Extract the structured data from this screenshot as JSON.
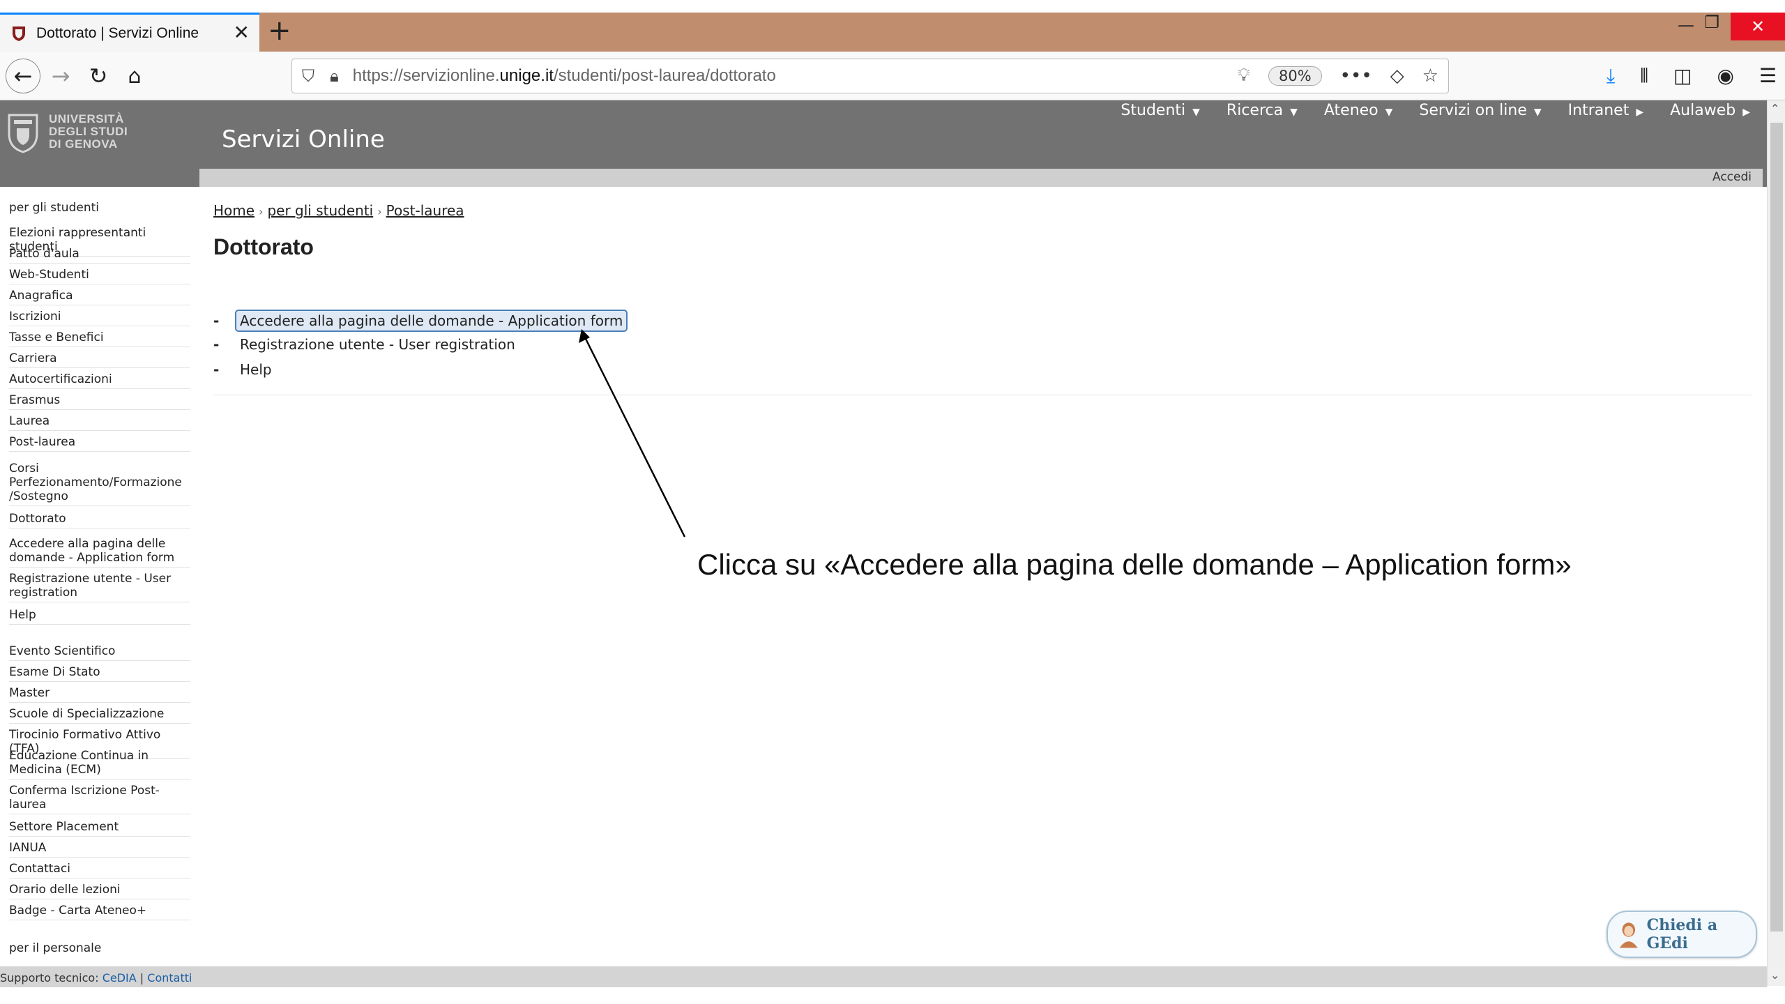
{
  "browser": {
    "tab_title": "Dottorato | Servizi Online",
    "url_prefix": "https://servizionline.",
    "url_domain": "unige.it",
    "url_path": "/studenti/post-laurea/dottorato",
    "zoom": "80%"
  },
  "site": {
    "logo_line1": "UNIVERSITÀ",
    "logo_line2": "DEGLI STUDI",
    "logo_line3": "DI GENOVA",
    "title": "Servizi Online",
    "accedi": "Accedi",
    "menu": [
      "Studenti",
      "Ricerca",
      "Ateneo",
      "Servizi on line",
      "Intranet",
      "Aulaweb"
    ]
  },
  "sidebar": {
    "head1": "per gli studenti",
    "items": [
      "Elezioni rappresentanti studenti",
      "Patto d'aula",
      "Web-Studenti",
      "Anagrafica",
      "Iscrizioni",
      "Tasse e Benefici",
      "Carriera",
      "Autocertificazioni",
      "Erasmus",
      "Laurea",
      "Post-laurea",
      "Corsi Perfezionamento/Formazione /Sostegno",
      "Dottorato",
      "Accedere alla pagina delle domande - Application form",
      "Registrazione utente - User registration",
      "Help",
      "Evento Scientifico",
      "Esame Di Stato",
      "Master",
      "Scuole di Specializzazione",
      "Tirocinio Formativo Attivo (TFA)",
      "Educazione Continua in Medicina (ECM)",
      "Conferma Iscrizione Post-laurea",
      "Settore Placement",
      "IANUA",
      "Contattaci",
      "Orario delle lezioni",
      "Badge - Carta Ateneo+"
    ],
    "head2": "per il personale"
  },
  "main": {
    "breadcrumb": [
      "Home",
      "per gli studenti",
      "Post-laurea"
    ],
    "title": "Dottorato",
    "links": [
      "Accedere alla pagina delle domande - Application form",
      "Registrazione utente - User registration",
      "Help"
    ],
    "dash": "-"
  },
  "annotation": "Clicca su «Accedere alla pagina delle domande – Application form»",
  "footer": {
    "label": "Supporto tecnico:",
    "link1": "CeDIA",
    "separator": "|",
    "link2": "Contatti"
  },
  "chat": {
    "label": "Chiedi a GEdi"
  }
}
